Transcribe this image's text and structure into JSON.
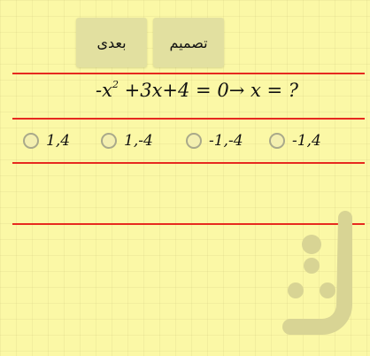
{
  "toolbar": {
    "next_label": "بعدی",
    "decide_label": "تصمیم"
  },
  "question": {
    "lhs_a": "-x",
    "exponent": "2",
    "lhs_b": " +3x+4  = 0",
    "arrow": "→",
    "rhs": " x  = ?"
  },
  "options": [
    {
      "label": "1,4",
      "selected": false
    },
    {
      "label": "1,-4",
      "selected": false
    },
    {
      "label": "-1,-4",
      "selected": false
    },
    {
      "label": "-1,4",
      "selected": false
    }
  ],
  "colors": {
    "background": "#fbf8a6",
    "line": "#e62a1f",
    "button": "#e2e0a0",
    "watermark": "#d8d494"
  },
  "watermark": {
    "name": "bazaar-logo"
  }
}
